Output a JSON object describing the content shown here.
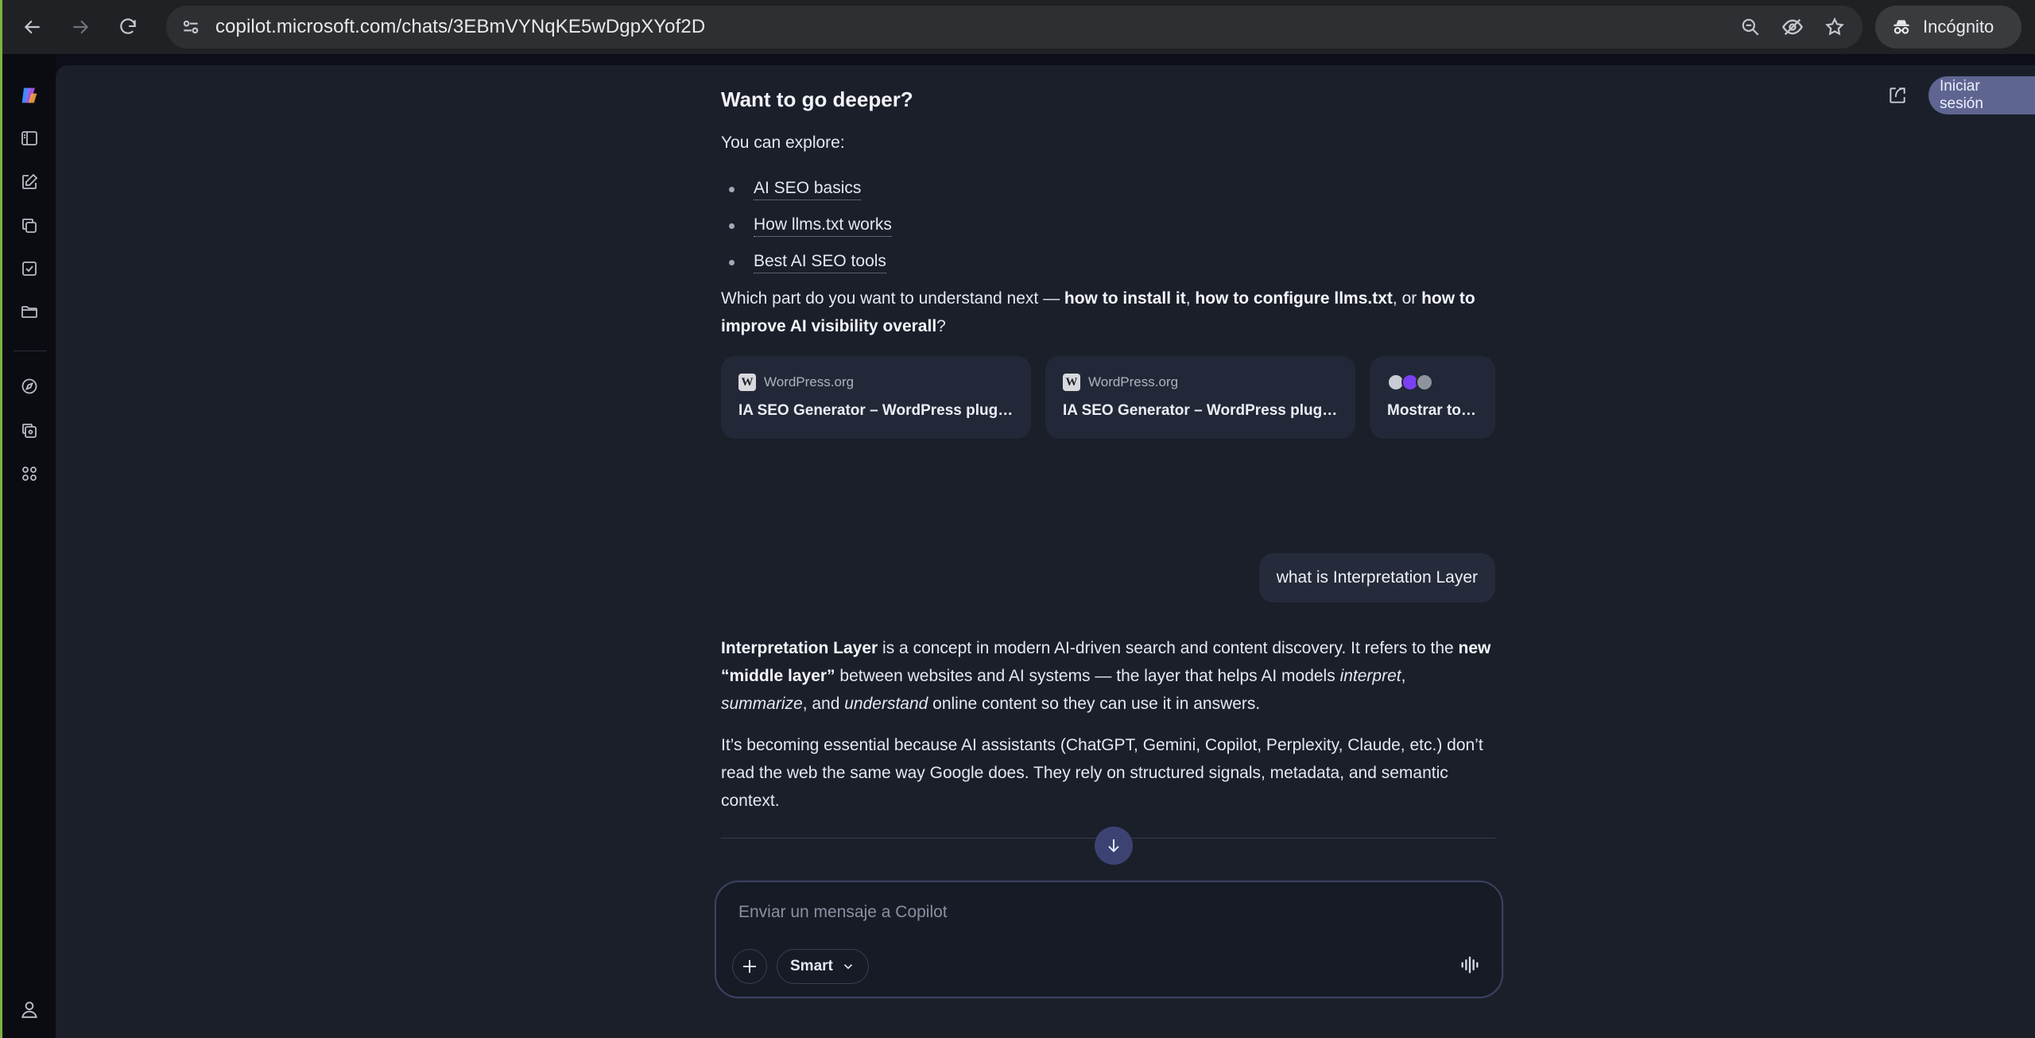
{
  "browser": {
    "url": "copilot.microsoft.com/chats/3EBmVYNqKE5wDgpXYof2D",
    "incognito_label": "Incógnito"
  },
  "header": {
    "login_label": "Iniciar sesión"
  },
  "composer": {
    "placeholder": "Enviar un mensaje a Copilot",
    "mode_label": "Smart"
  },
  "chat": {
    "heading": "Want to go deeper?",
    "explore_intro": "You can explore:",
    "bullets": [
      {
        "label": "AI SEO basics"
      },
      {
        "label": "How llms.txt works"
      },
      {
        "label": "Best AI SEO tools"
      }
    ],
    "question": {
      "t1": "Which part do you want to understand next — ",
      "b1": "how to install it",
      "t2": ", ",
      "b2": "how to configure llms.txt",
      "t3": ", or ",
      "b3": "how to improve AI visibility overall",
      "t4": "?"
    },
    "source_cards": [
      {
        "source": "WordPress.org",
        "title": "IA SEO Generator – WordPress plugi..."
      },
      {
        "source": "WordPress.org",
        "title": "IA SEO Generator – WordPress plugi..."
      }
    ],
    "show_all_label": "Mostrar todo",
    "user_message": "what is Interpretation Layer",
    "answer1": {
      "b1": "Interpretation Layer",
      "t1": " is a concept in modern AI-driven search and content discovery. It refers to the ",
      "b2": "new “middle layer”",
      "t2": " between websites and AI systems — the layer that helps AI models ",
      "i1": "interpret",
      "t3": ", ",
      "i2": "summarize",
      "t4": ", and ",
      "i3": "understand",
      "t5": " online content so they can use it in answers."
    },
    "answer2": "It’s becoming essential because AI assistants (ChatGPT, Gemini, Copilot, Perplexity, Claude, etc.) don’t read the web the same way Google does. They rely on structured signals, metadata, and semantic context."
  },
  "colors": {
    "accent": "#5e6590",
    "background": "#1b1f2a",
    "rail": "#0a0c12",
    "card": "#232838"
  },
  "icons": {
    "rail": [
      "copilot-logo-icon",
      "sidebar-toggle-icon",
      "new-chat-icon",
      "library-icon",
      "tasks-icon",
      "folder-icon",
      "discover-icon",
      "image-create-icon",
      "apps-icon",
      "account-icon"
    ]
  }
}
